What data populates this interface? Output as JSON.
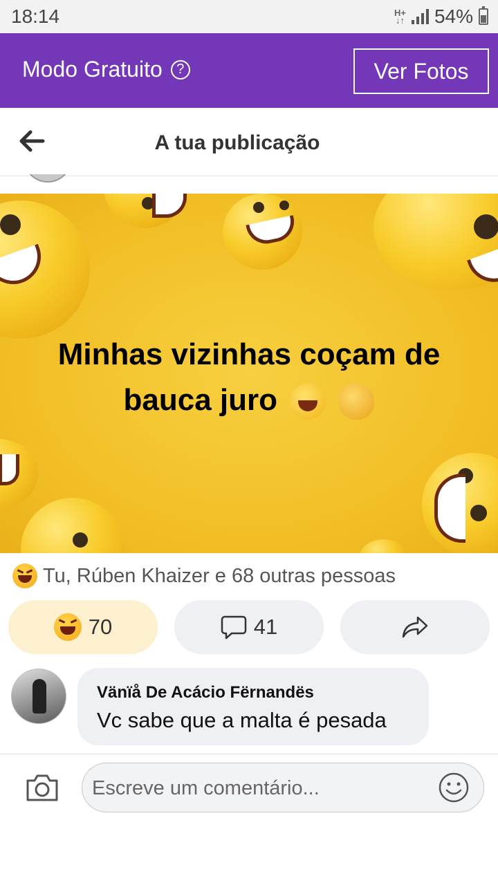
{
  "status_bar": {
    "time": "18:14",
    "network": "H+",
    "battery": "54%",
    "battery_level": 0.54
  },
  "banner": {
    "label": "Modo Gratuito",
    "help_icon": "question-circle-icon",
    "button": "Ver Fotos"
  },
  "header": {
    "back_icon": "arrow-left-icon",
    "title": "A tua publicação"
  },
  "post": {
    "text_line1": "Minhas vizinhas coçam de",
    "text_line2": "bauca juro",
    "emojis": [
      "rolling-laughing-emoji",
      "ok-hand-emoji"
    ],
    "background_color": "#f3c12c"
  },
  "reactions": {
    "summary": "Tu, Rúben Khaizer e 68 outras pessoas",
    "icon": "haha-icon"
  },
  "actions": {
    "haha_count": "70",
    "comment_count": "41",
    "comment_icon": "comment-icon",
    "share_icon": "share-icon"
  },
  "comment": {
    "author": "Vänïå De Acácio Fërnandës",
    "text": "Vc sabe que a malta é pesada"
  },
  "composer": {
    "placeholder": "Escreve um comentário...",
    "camera_icon": "camera-icon",
    "emoji_icon": "smiley-icon"
  },
  "colors": {
    "brand_purple": "#7437b8",
    "reaction_bg": "#fdf0cf",
    "button_bg": "#eef0f3"
  }
}
